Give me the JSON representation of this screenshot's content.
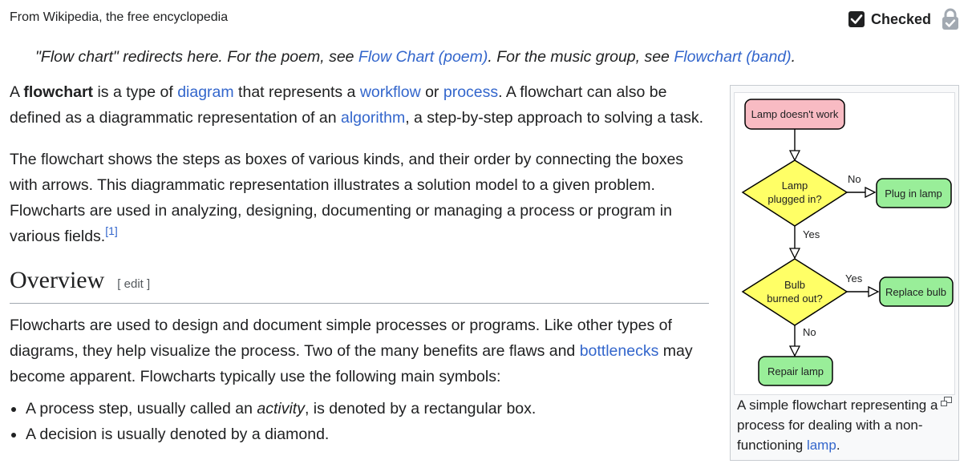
{
  "header": {
    "tagline": "From Wikipedia, the free encyclopedia",
    "checked_label": "Checked"
  },
  "hatnote": {
    "prefix": "\"Flow chart\" redirects here. For the poem, see ",
    "link1": "Flow Chart (poem)",
    "middle": ". For the music group, see ",
    "link2": "Flowchart (band)",
    "suffix": "."
  },
  "intro": {
    "p1": {
      "t0": "A ",
      "bold": "flowchart",
      "t1": " is a type of ",
      "link_diagram": "diagram",
      "t2": " that represents a ",
      "link_workflow": "workflow",
      "t3": " or ",
      "link_process": "process",
      "t4": ". A flowchart can also be defined as a diagrammatic representation of an ",
      "link_algorithm": "algorithm",
      "t5": ", a step-by-step approach to solving a task."
    },
    "p2": {
      "text": "The flowchart shows the steps as boxes of various kinds, and their order by connecting the boxes with arrows. This diagrammatic representation illustrates a solution model to a given problem. Flowcharts are used in analyzing, designing, documenting or managing a process or program in various fields.",
      "ref": "[1]"
    }
  },
  "overview": {
    "heading": "Overview",
    "edit": "[ edit ]",
    "p1": {
      "t0": "Flowcharts are used to design and document simple processes or programs. Like other types of diagrams, they help visualize the process. Two of the many benefits are flaws and ",
      "link_bottlenecks": "bottlenecks",
      "t1": " may become apparent. Flowcharts typically use the following main symbols:"
    },
    "bullets": [
      {
        "t0": "A process step, usually called an ",
        "em": "activity",
        "t1": ", is denoted by a rectangular box."
      },
      {
        "t0": "A decision is usually denoted by a diamond."
      }
    ]
  },
  "figure": {
    "nodes": {
      "start": "Lamp doesn't work",
      "d1_line1": "Lamp",
      "d1_line2": "plugged in?",
      "plug": "Plug in lamp",
      "d2_line1": "Bulb",
      "d2_line2": "burned out?",
      "replace": "Replace bulb",
      "repair": "Repair lamp"
    },
    "edges": {
      "d1_no": "No",
      "d1_yes": "Yes",
      "d2_yes": "Yes",
      "d2_no": "No"
    },
    "colors": {
      "start_fill": "#f8bbc3",
      "decision_fill": "#ffff66",
      "action_fill": "#99ee99"
    },
    "caption": {
      "t0": "A simple flowchart representing a process for dealing with a non-functioning ",
      "link": "lamp",
      "t1": "."
    }
  }
}
